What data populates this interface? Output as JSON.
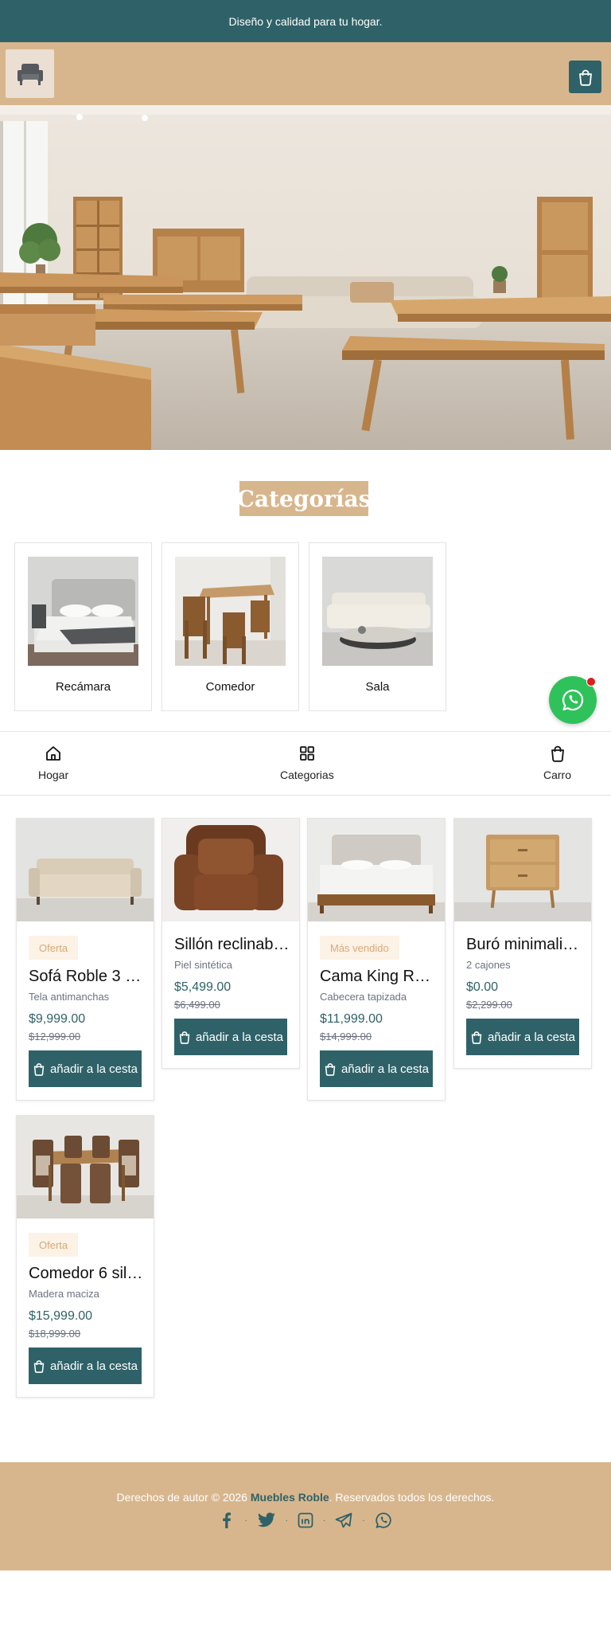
{
  "topbar": {
    "text": "Diseño y calidad para tu hogar."
  },
  "header": {
    "logo": "armchair-icon",
    "cart_icon": "shopping-bag-icon"
  },
  "hero": {
    "image": "furniture-showroom-photo"
  },
  "categories": {
    "title": "Categorías",
    "items": [
      {
        "label": "Recámara",
        "image": "bed-photo"
      },
      {
        "label": "Comedor",
        "image": "dining-table-photo"
      },
      {
        "label": "Sala",
        "image": "sofa-photo"
      }
    ]
  },
  "bottom_nav": {
    "items": [
      {
        "label": "Hogar",
        "icon": "home-icon"
      },
      {
        "label": "Categorias",
        "icon": "grid-icon"
      },
      {
        "label": "Carro",
        "icon": "shopping-bag-icon"
      }
    ]
  },
  "products": [
    {
      "badge": "Oferta",
      "name": "Sofá Roble 3 …",
      "desc": "Tela antimanchas",
      "price": "$9,999.00",
      "old_price": "$12,999.00",
      "cta": "añadir a la cesta"
    },
    {
      "badge": "",
      "name": "Sillón reclinabl…",
      "desc": "Piel sintética",
      "price": "$5,499.00",
      "old_price": "$6,499.00",
      "cta": "añadir a la cesta"
    },
    {
      "badge": "Más vendido",
      "name": "Cama King Ro…",
      "desc": "Cabecera tapizada",
      "price": "$11,999.00",
      "old_price": "$14,999.00",
      "cta": "añadir a la cesta"
    },
    {
      "badge": "",
      "name": "Buró minimali…",
      "desc": "2 cajones",
      "price": "$0.00",
      "old_price": "$2,299.00",
      "cta": "añadir a la cesta"
    },
    {
      "badge": "Oferta",
      "name": "Comedor 6 sil…",
      "desc": "Madera maciza",
      "price": "$15,999.00",
      "old_price": "$18,999.00",
      "cta": "añadir a la cesta"
    }
  ],
  "footer": {
    "copy_prefix": "Derechos de autor © 2026",
    "brand": "Muebles Roble",
    "copy_suffix": ". Reservados todos los derechos.",
    "socials": [
      "facebook-icon",
      "twitter-icon",
      "linkedin-icon",
      "telegram-icon",
      "whatsapp-icon"
    ]
  },
  "colors": {
    "primary": "#2f6268",
    "tan": "#d8b68d",
    "badge_bg": "#fcf2e6",
    "whatsapp": "#2fc25b"
  }
}
